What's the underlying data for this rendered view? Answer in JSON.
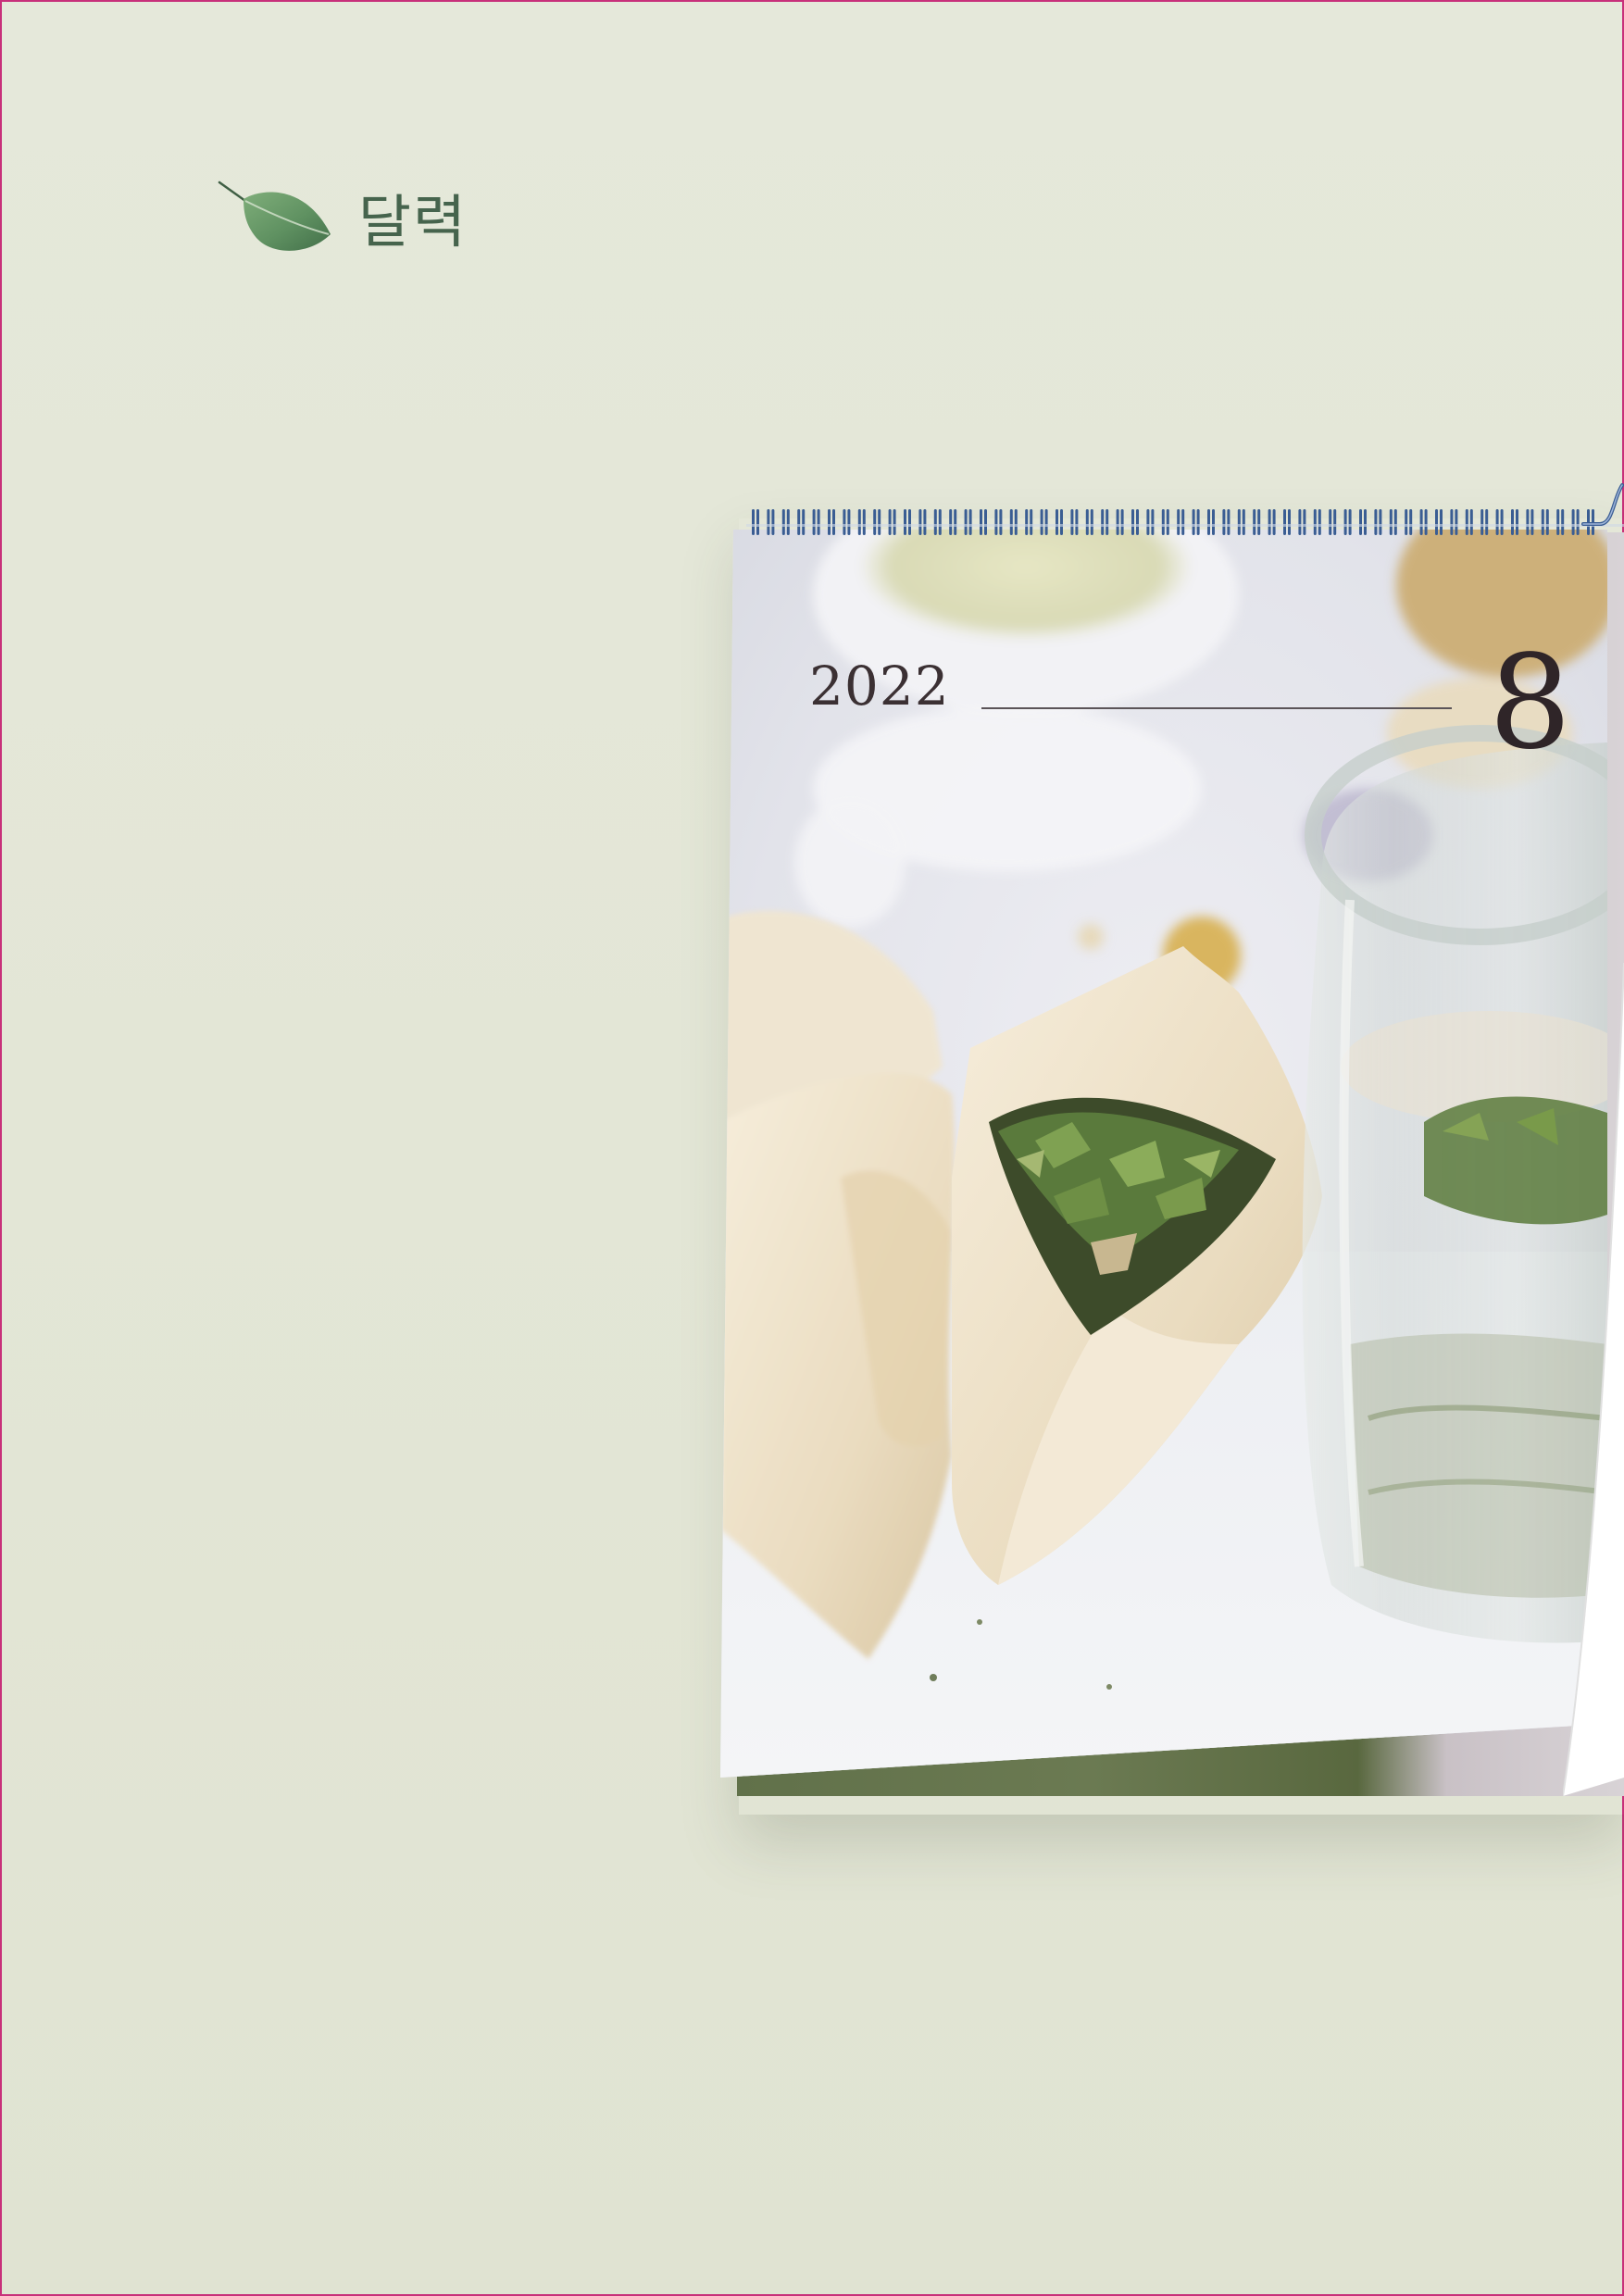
{
  "header": {
    "title": "달력",
    "icon": "leaf-icon"
  },
  "calendar": {
    "year": "2022",
    "month": "8",
    "photo": "tea-bags-and-herb-jar-photo"
  },
  "colors": {
    "background": "#e4e7d8",
    "title": "#46644d",
    "leaf": "#5c8f5c",
    "spiral": "#3a5d93",
    "date_text": "#2f2528",
    "border": "#c8307a"
  }
}
